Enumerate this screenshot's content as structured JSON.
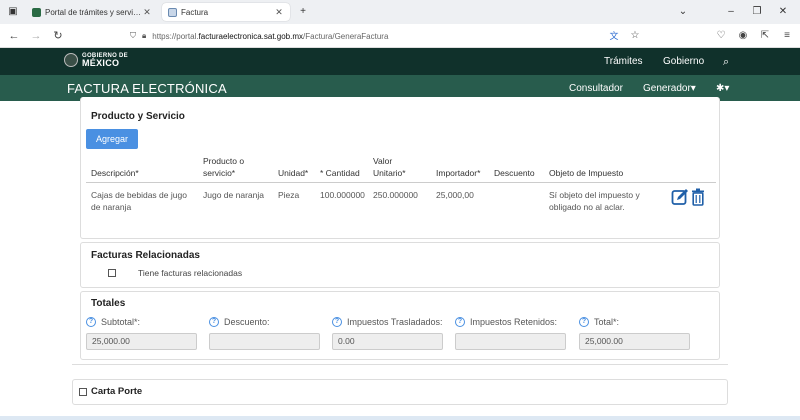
{
  "browser": {
    "tabs": [
      {
        "title": "Portal de trámites y servicios - SAT"
      },
      {
        "title": "Factura"
      }
    ],
    "new_tab": "+",
    "url_prefix": "https://portal.",
    "url_domain": "facturaelectronica.sat.gob.mx",
    "url_path": "/Factura/GeneraFactura"
  },
  "gov": {
    "logo_small": "GOBIERNO DE",
    "logo_big": "MÉXICO",
    "links": [
      "Trámites",
      "Gobierno"
    ]
  },
  "app": {
    "title": "FACTURA ELECTRÓNICA",
    "nav": {
      "consultador": "Consultador",
      "generador": "Generador▾",
      "settings": "✱▾"
    }
  },
  "producto": {
    "title": "Producto y Servicio",
    "add_button": "Agregar",
    "columns": {
      "descripcion": "Descripción*",
      "producto_l1": "Producto o",
      "producto_l2": "servicio*",
      "unidad": "Unidad*",
      "cantidad": "* Cantidad",
      "valor_l1": "Valor",
      "valor_l2": "Unitario*",
      "importe": "Importador*",
      "descuento": "Descuento",
      "objeto": "Objeto de Impuesto"
    },
    "row": {
      "descripcion_l1": "Cajas de bebidas de jugo",
      "descripcion_l2": "de naranja",
      "producto": "Jugo de naranja",
      "unidad": "Pieza",
      "cantidad": "100.000000",
      "valor": "250.000000",
      "importe": "25,000,00",
      "descuento": "",
      "objeto_l1": "Sí objeto del impuesto y",
      "objeto_l2": "obligado no al aclar."
    }
  },
  "relacionadas": {
    "title": "Facturas Relacionadas",
    "checkbox_label": "Tiene facturas relacionadas"
  },
  "totales": {
    "title": "Totales",
    "fields": [
      {
        "label": "Subtotal*:",
        "value": "25,000.00"
      },
      {
        "label": "Descuento:",
        "value": ""
      },
      {
        "label": "Impuestos Trasladados:",
        "value": "0.00"
      },
      {
        "label": "Impuestos Retenidos:",
        "value": ""
      },
      {
        "label": "Total*:",
        "value": "25,000.00"
      }
    ]
  },
  "carta_porte": {
    "label": "Carta Porte"
  },
  "colors": {
    "gov_bar": "#10312b",
    "app_bar": "#285c4d",
    "primary": "#4a90e2",
    "icon_blue": "#1f5fa8"
  }
}
